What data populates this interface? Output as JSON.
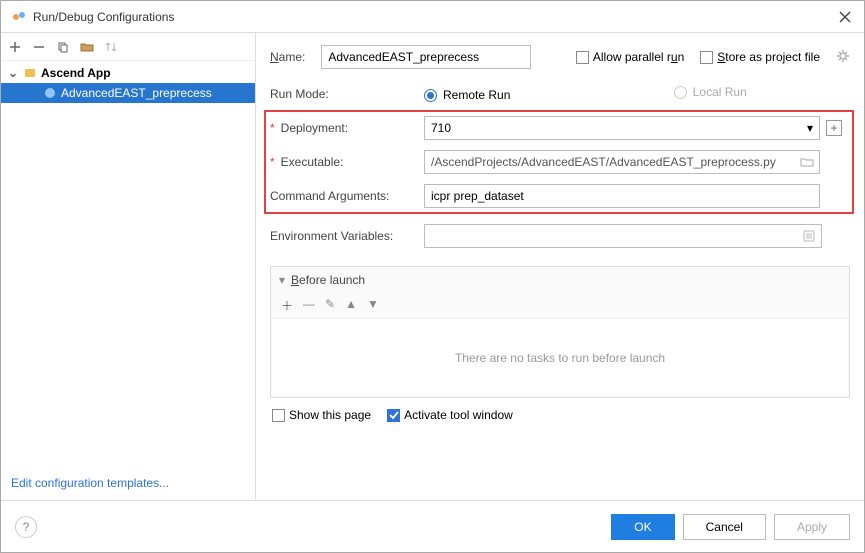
{
  "window": {
    "title": "Run/Debug Configurations"
  },
  "tree": {
    "group_label": "Ascend App",
    "item_label": "AdvancedEAST_preprecess"
  },
  "left": {
    "edit_templates": "Edit configuration templates..."
  },
  "form": {
    "name_label_pre": "N",
    "name_label_post": "ame:",
    "name_value": "AdvancedEAST_preprecess",
    "allow_parallel": "Allow parallel run",
    "allow_parallel_u": "u",
    "store_pre": "S",
    "store_post": "tore as project file",
    "run_mode_label": "Run Mode:",
    "remote_run": "Remote Run",
    "local_run": "Local Run",
    "deployment_label": "Deployment:",
    "deployment_value": "710",
    "executable_label": "Executable:",
    "executable_value": "/AscendProjects/AdvancedEAST/AdvancedEAST_preprocess.py",
    "args_label": "Command Arguments:",
    "args_value": "icpr prep_dataset",
    "env_label": "Environment Variables:",
    "env_value": ""
  },
  "before_launch": {
    "title_pre": "B",
    "title_post": "efore launch",
    "empty_text": "There are no tasks to run before launch",
    "show_this_page": "Show this page",
    "activate_tool": "Activate tool window"
  },
  "footer": {
    "ok": "OK",
    "cancel": "Cancel",
    "apply": "Apply"
  }
}
